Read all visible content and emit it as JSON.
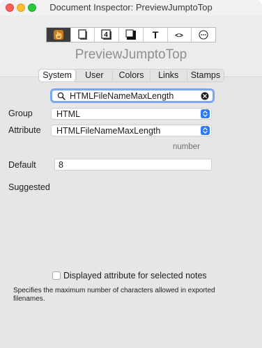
{
  "window": {
    "title": "Document Inspector: PreviewJumptoTop",
    "traffic_lights": [
      "close",
      "minimize",
      "zoom"
    ]
  },
  "toolbar": {
    "icons": [
      {
        "name": "hand-pointer-icon",
        "selected": true
      },
      {
        "name": "note-icon",
        "selected": false
      },
      {
        "name": "four-icon",
        "selected": false
      },
      {
        "name": "shadow-note-icon",
        "selected": false
      },
      {
        "name": "text-icon",
        "selected": false
      },
      {
        "name": "code-icon",
        "selected": false
      },
      {
        "name": "more-icon",
        "selected": false
      }
    ],
    "text_icon_glyph": "T",
    "code_icon_glyph": "<>",
    "four_icon_glyph": "4"
  },
  "header": {
    "title": "PreviewJumptoTop"
  },
  "tabs": [
    {
      "label": "System",
      "selected": true
    },
    {
      "label": "User",
      "selected": false
    },
    {
      "label": "Colors",
      "selected": false
    },
    {
      "label": "Links",
      "selected": false
    },
    {
      "label": "Stamps",
      "selected": false
    }
  ],
  "search": {
    "value": "HTMLFileNameMaxLength"
  },
  "form": {
    "group_label": "Group",
    "group_value": "HTML",
    "attribute_label": "Attribute",
    "attribute_value": "HTMLFileNameMaxLength",
    "type_note": "number",
    "default_label": "Default",
    "default_value": "8",
    "suggested_label": "Suggested"
  },
  "checkbox": {
    "label": "Displayed attribute for selected notes",
    "checked": false
  },
  "description": "Specifies the maximum number of characters allowed in exported filenames.",
  "colors": {
    "accent": "#2f7cf6",
    "focus_ring": "#7aa8f0",
    "close": "#fe5f57",
    "minimize": "#febc2e",
    "zoom": "#28c840"
  }
}
